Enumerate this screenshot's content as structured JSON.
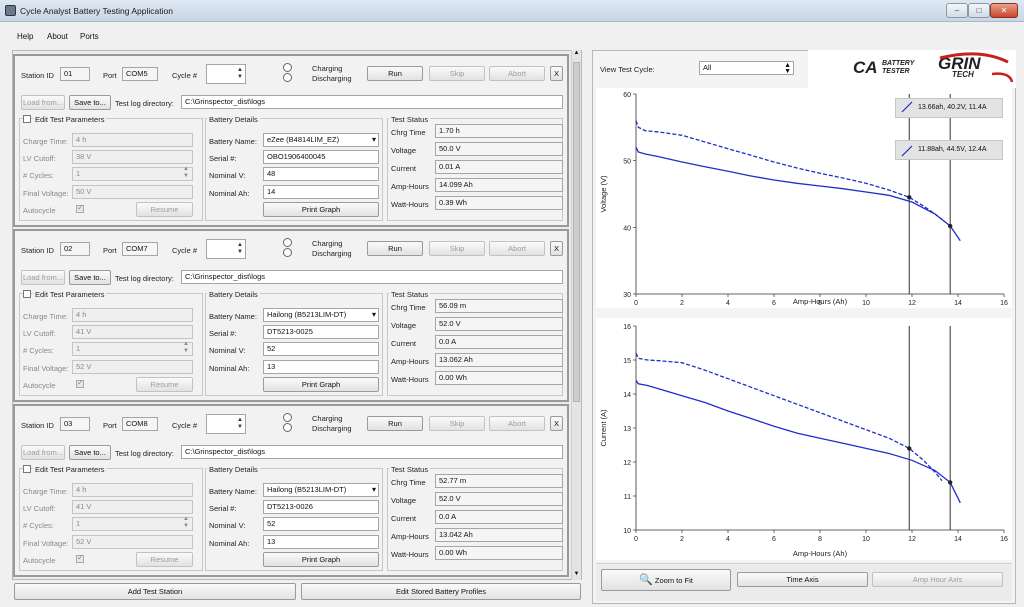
{
  "window": {
    "title": "Cycle Analyst Battery Testing Application"
  },
  "menu": {
    "items": [
      "Help",
      "About",
      "Ports"
    ]
  },
  "labels": {
    "station_id": "Station ID",
    "port": "Port",
    "cycle": "Cycle #",
    "charging": "Charging",
    "discharging": "Discharging",
    "run": "Run",
    "skip": "Skip",
    "abort": "Abort",
    "close": "X",
    "load_from": "Load from...",
    "save_to": "Save to...",
    "test_log_dir": "Test log directory:",
    "edit_test_params": "Edit Test Parameters",
    "charge_time": "Charge Time:",
    "lv_cutoff": "LV Cutoff:",
    "cycles": "# Cycles:",
    "final_voltage": "Final Voltage:",
    "autocycle": "Autocycle",
    "resume": "Resume",
    "battery_details": "Battery Details",
    "battery_name": "Battery Name:",
    "serial": "Serial #:",
    "nominal_v": "Nominal V:",
    "nominal_ah": "Nominal Ah:",
    "print_graph": "Print Graph",
    "test_status": "Test Status",
    "chrg_time": "Chrg Time",
    "voltage": "Voltage",
    "current": "Current",
    "amp_hours": "Amp-Hours",
    "watt_hours": "Watt-Hours"
  },
  "stations": [
    {
      "id": "01",
      "port": "COM5",
      "log_dir": "C:\\Grinspector_dist\\logs",
      "params": {
        "charge_time": "4 h",
        "lv_cutoff": "38 V",
        "cycles": "1",
        "final_voltage": "50 V"
      },
      "battery": {
        "name": "eZee (B4814LIM_EZ)",
        "serial": "OBO1906400045",
        "nominal_v": "48",
        "nominal_ah": "14"
      },
      "status": {
        "chrg_time": "1.70 h",
        "voltage": "50.0 V",
        "current": "0.01 A",
        "amp_hours": "14.099 Ah",
        "watt_hours": "0.39 Wh"
      }
    },
    {
      "id": "02",
      "port": "COM7",
      "log_dir": "C:\\Grinspector_dist\\logs",
      "params": {
        "charge_time": "4 h",
        "lv_cutoff": "41 V",
        "cycles": "1",
        "final_voltage": "52 V"
      },
      "battery": {
        "name": "Hailong (B5213LIM-DT)",
        "serial": "DT5213-0025",
        "nominal_v": "52",
        "nominal_ah": "13"
      },
      "status": {
        "chrg_time": "56.09 m",
        "voltage": "52.0 V",
        "current": "0.0 A",
        "amp_hours": "13.062 Ah",
        "watt_hours": "0.00 Wh"
      }
    },
    {
      "id": "03",
      "port": "COM8",
      "log_dir": "C:\\Grinspector_dist\\logs",
      "params": {
        "charge_time": "4 h",
        "lv_cutoff": "41 V",
        "cycles": "1",
        "final_voltage": "52 V"
      },
      "battery": {
        "name": "Hailong (B5213LIM-DT)",
        "serial": "DT5213-0026",
        "nominal_v": "52",
        "nominal_ah": "13"
      },
      "status": {
        "chrg_time": "52.77 m",
        "voltage": "52.0 V",
        "current": "0.0 A",
        "amp_hours": "13.042 Ah",
        "watt_hours": "0.00 Wh"
      }
    }
  ],
  "bottom": {
    "add_station": "Add Test Station",
    "edit_profiles": "Edit Stored Battery Profiles"
  },
  "right": {
    "view_test_cycle": "View Test Cycle:",
    "cycle_value": "All",
    "logo_ca": "CA",
    "logo_battery": "BATTERY",
    "logo_tester": "TESTER",
    "logo_grin": "GRIN",
    "logo_tech": "TECH",
    "zoom_to_fit": "Zoom to Fit",
    "time_axis": "Time Axis",
    "amp_hour_axis": "Amp Hour Axis"
  },
  "annotations": [
    "13.66ah, 40.2V, 11.4A",
    "11.88ah, 44.5V, 12.4A"
  ],
  "chart_data": [
    {
      "type": "line",
      "xlabel": "Amp-Hours (Ah)",
      "ylabel": "Voltage (V)",
      "xlim": [
        0,
        16
      ],
      "ylim": [
        30,
        60
      ],
      "xticks": [
        0,
        2,
        4,
        6,
        8,
        10,
        12,
        14,
        16
      ],
      "yticks": [
        30,
        40,
        50,
        60
      ],
      "cursors_x": [
        11.88,
        13.66
      ],
      "series": [
        {
          "style": "dashed",
          "x": [
            0,
            0.1,
            0.4,
            1,
            2,
            3,
            4,
            5,
            6,
            7,
            8,
            9,
            10,
            11,
            11.88,
            12.5,
            13.0,
            13.3
          ],
          "y": [
            56,
            55,
            54.5,
            54.3,
            53.8,
            52.8,
            51.8,
            50.8,
            49.8,
            48.9,
            48.1,
            47.4,
            46.6,
            45.6,
            44.5,
            43.2,
            42.0,
            41.2
          ]
        },
        {
          "style": "solid",
          "x": [
            0,
            0.1,
            0.4,
            1,
            2,
            3,
            4,
            5,
            6,
            7,
            8,
            9,
            10,
            11,
            12,
            13,
            13.66,
            14.1
          ],
          "y": [
            52,
            51.3,
            51.0,
            50.6,
            49.8,
            49.1,
            48.4,
            47.7,
            47.1,
            46.6,
            46.2,
            45.8,
            45.3,
            44.8,
            43.8,
            42.0,
            40.2,
            38.0
          ]
        }
      ]
    },
    {
      "type": "line",
      "xlabel": "Amp-Hours (Ah)",
      "ylabel": "Current (A)",
      "xlim": [
        0,
        16
      ],
      "ylim": [
        10,
        16
      ],
      "xticks": [
        0,
        2,
        4,
        6,
        8,
        10,
        12,
        14,
        16
      ],
      "yticks": [
        10,
        11,
        12,
        13,
        14,
        15,
        16
      ],
      "cursors_x": [
        11.88,
        13.66
      ],
      "series": [
        {
          "style": "dashed",
          "x": [
            0,
            0.1,
            0.5,
            1,
            2,
            3,
            4,
            5,
            6,
            7,
            8,
            9,
            10,
            11,
            11.88,
            12.5,
            13.0,
            13.3
          ],
          "y": [
            15.2,
            15.05,
            15.0,
            14.98,
            14.92,
            14.7,
            14.45,
            14.2,
            13.95,
            13.7,
            13.45,
            13.2,
            12.95,
            12.7,
            12.4,
            12.05,
            11.7,
            11.45
          ]
        },
        {
          "style": "solid",
          "x": [
            0,
            0.1,
            0.5,
            1,
            2,
            3,
            4,
            5,
            6,
            7,
            8,
            9,
            10,
            11,
            12,
            13,
            13.66,
            14.1
          ],
          "y": [
            14.4,
            14.3,
            14.25,
            14.15,
            13.95,
            13.75,
            13.5,
            13.28,
            13.05,
            12.85,
            12.7,
            12.55,
            12.4,
            12.25,
            12.05,
            11.75,
            11.4,
            10.8
          ]
        }
      ]
    }
  ]
}
